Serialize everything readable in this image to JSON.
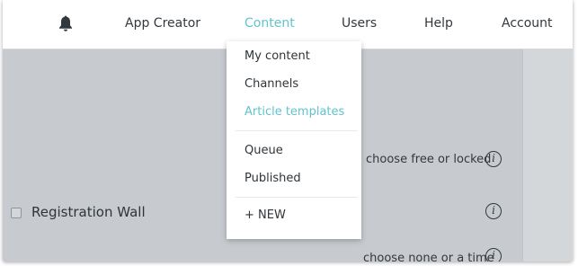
{
  "nav": {
    "items": [
      {
        "label": "App Creator",
        "active": false
      },
      {
        "label": "Content",
        "active": true
      },
      {
        "label": "Users",
        "active": false
      },
      {
        "label": "Help",
        "active": false
      },
      {
        "label": "Account",
        "active": false
      }
    ]
  },
  "dropdown": {
    "items": [
      {
        "label": "My content",
        "active": false
      },
      {
        "label": "Channels",
        "active": false
      },
      {
        "label": "Article templates",
        "active": true
      },
      {
        "label": "Queue",
        "active": false
      },
      {
        "label": "Published",
        "active": false
      },
      {
        "label": "+ NEW",
        "active": false
      }
    ]
  },
  "settings": {
    "free_or_locked": "choose free or locked",
    "registration_wall": "Registration Wall",
    "none_or_time": "choose none or a time"
  },
  "icons": {
    "bell": "bell-icon",
    "info": "info-icon",
    "info_glyph": "i"
  },
  "colors": {
    "accent": "#62c3cf",
    "text": "#33383d",
    "backdrop": "#c7cbcf"
  }
}
